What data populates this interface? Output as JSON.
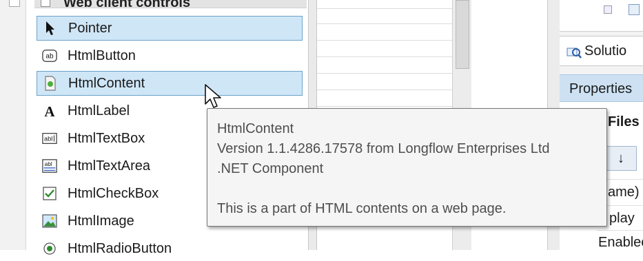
{
  "toolbox": {
    "group_title": "Web client controls",
    "items": [
      {
        "label": "Pointer",
        "icon": "pointer-arrow-icon",
        "selected": true
      },
      {
        "label": "HtmlButton",
        "icon": "button-ab-icon",
        "selected": false
      },
      {
        "label": "HtmlContent",
        "icon": "html-content-icon",
        "selected": true
      },
      {
        "label": "HtmlLabel",
        "icon": "label-A-icon",
        "selected": false
      },
      {
        "label": "HtmlTextBox",
        "icon": "textbox-icon",
        "selected": false
      },
      {
        "label": "HtmlTextArea",
        "icon": "textarea-icon",
        "selected": false
      },
      {
        "label": "HtmlCheckBox",
        "icon": "checkbox-icon",
        "selected": false
      },
      {
        "label": "HtmlImage",
        "icon": "image-icon",
        "selected": false
      },
      {
        "label": "HtmlRadioButton",
        "icon": "radio-button-icon",
        "selected": false
      }
    ]
  },
  "tooltip": {
    "name": "HtmlContent",
    "version": "Version 1.1.4286.17578 from Longflow Enterprises Ltd",
    "component_type": ".NET Component",
    "description": "This is a part of HTML contents on a web page."
  },
  "right_panel": {
    "solution_tab": "Solutio",
    "properties_header": "Properties",
    "files_label": "Files",
    "sort_glyph": "↓",
    "rows": [
      "ame)",
      "play",
      "Enablec"
    ]
  },
  "colors": {
    "selected_bg": "#cfe6f7",
    "selected_border": "#6aa2c8",
    "tooltip_bg": "#f5f5f6",
    "tooltip_text": "#4e4e4e",
    "properties_header_bg": "#cde1f3"
  }
}
